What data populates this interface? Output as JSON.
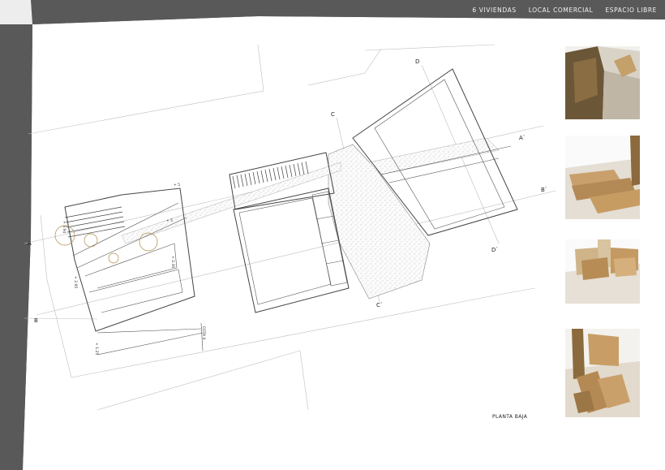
{
  "nav": {
    "items": [
      "6 VIVIENDAS",
      "LOCAL COMERCIAL",
      "ESPACIO LIBRE"
    ]
  },
  "plan": {
    "caption": "PLANTA BAJA",
    "section_marks": {
      "a": "A",
      "a_prime": "A`",
      "b": "B",
      "b_prime": "B`",
      "c": "C",
      "c_prime": "C`",
      "d": "D",
      "d_prime": "D`"
    },
    "levels": {
      "plus_5": "+ 5",
      "plus_5_small": "+ 5",
      "plus_3_94": "+ 3.94",
      "plus_2_95": "+ 2.95",
      "plus_2_30": "+ 2.30",
      "plus_1_25": "+ 1.25",
      "cota_0": "COTA 0"
    }
  },
  "photos": [
    {
      "name": "model-photo-1"
    },
    {
      "name": "model-photo-2"
    },
    {
      "name": "model-photo-3"
    },
    {
      "name": "model-photo-4"
    }
  ],
  "colors": {
    "frame": "#595959",
    "nav_text": "#f2f2f2",
    "line": "#555555",
    "wood": "#c9a06b"
  }
}
